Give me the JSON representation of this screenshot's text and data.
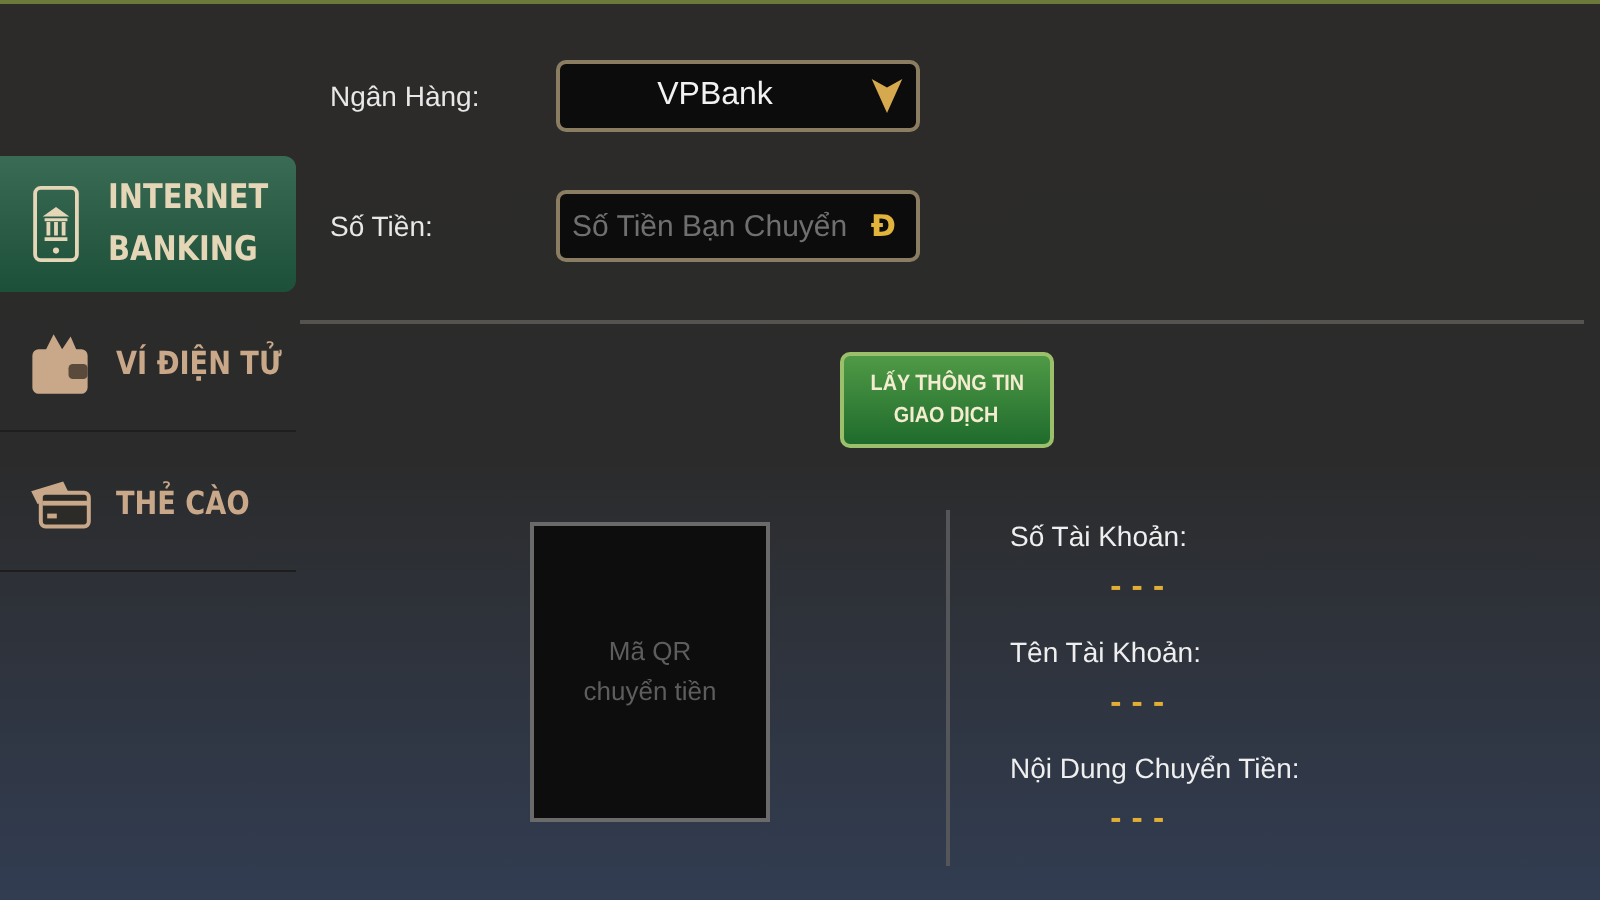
{
  "sidebar": {
    "items": [
      {
        "kind": "bank",
        "label_lines": [
          "INTERNET",
          "BANKING"
        ],
        "selected": true
      },
      {
        "kind": "wallet",
        "label_lines": [
          "VÍ ĐIỆN TỬ"
        ],
        "selected": false
      },
      {
        "kind": "card",
        "label_lines": [
          "THẺ CÀO"
        ],
        "selected": false
      }
    ]
  },
  "form": {
    "bank_label": "Ngân Hàng:",
    "bank_value": "VPBank",
    "amount_label": "Số Tiền:",
    "amount_placeholder": "Số Tiền Bạn Chuyển",
    "currency": "Đ"
  },
  "action_button": {
    "lines": [
      "LẤY THÔNG TIN",
      "GIAO DỊCH"
    ]
  },
  "qr": {
    "lines": [
      "Mã QR",
      "chuyển tiền"
    ]
  },
  "details": [
    {
      "label": "Số Tài Khoản:",
      "value": "- - -"
    },
    {
      "label": "Tên Tài Khoản:",
      "value": "- - -"
    },
    {
      "label": "Nội Dung Chuyển Tiền:",
      "value": "- - -"
    }
  ]
}
